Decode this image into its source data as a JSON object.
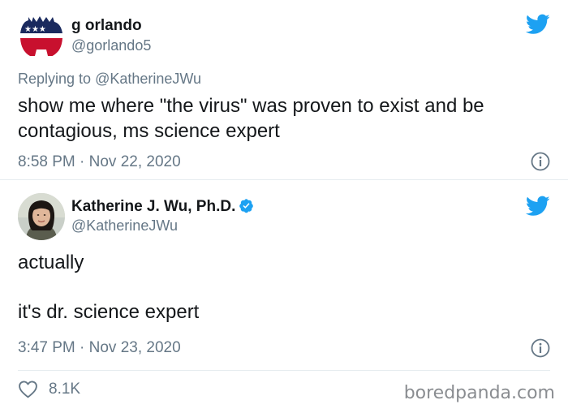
{
  "tweets": [
    {
      "user": {
        "name": "g orlando",
        "handle": "@gorlando5"
      },
      "replying_prefix": "Replying to ",
      "replying_to": "@KatherineJWu",
      "text": "show me where \"the virus\" was proven to exist and be contagious, ms science expert",
      "timestamp": "8:58 PM · Nov 22, 2020"
    },
    {
      "user": {
        "name": "Katherine J. Wu, Ph.D.",
        "handle": "@KatherineJWu",
        "verified": true
      },
      "text_line1": "actually",
      "text_line2": "it's dr. science expert",
      "timestamp": "3:47 PM · Nov 23, 2020",
      "likes": "8.1K"
    }
  ],
  "watermark": "boredpanda.com",
  "colors": {
    "twitter_blue": "#1da1f2",
    "secondary_text": "#657786",
    "primary_text": "#14171a"
  },
  "icons": [
    "twitter-bird-icon",
    "verified-badge-icon",
    "info-icon",
    "heart-icon"
  ]
}
